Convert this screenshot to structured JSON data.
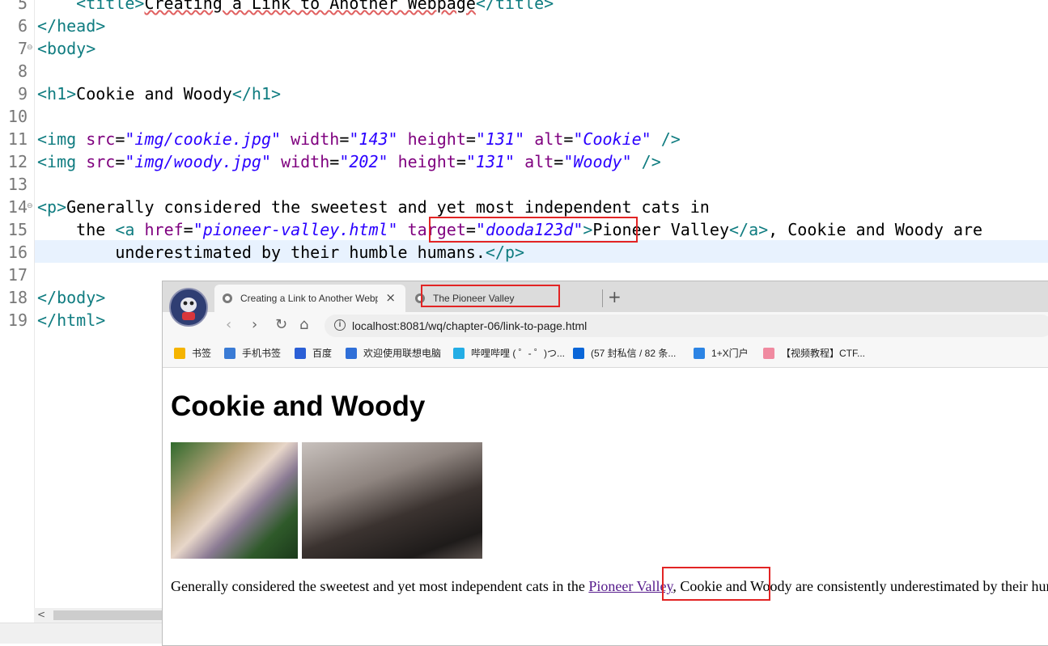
{
  "editor": {
    "line_numbers": [
      "5",
      "6",
      "7",
      "8",
      "9",
      "10",
      "11",
      "12",
      "13",
      "14",
      "15",
      "16",
      "17",
      "18",
      "19"
    ],
    "lines": {
      "l5": {
        "open": "<title>",
        "text": "Creating a Link to Another Webpage",
        "close": "</title>"
      },
      "l6": "</head>",
      "l7": "<body>",
      "l9": {
        "open": "<h1>",
        "text": "Cookie and Woody",
        "close": "</h1>"
      },
      "l11": {
        "tag": "<img",
        "src_attr": "src",
        "src": "\"img/cookie.jpg\"",
        "w_attr": "width",
        "w": "\"143\"",
        "h_attr": "height",
        "h": "\"131\"",
        "alt_attr": "alt",
        "alt": "\"Cookie\"",
        "end": "/>"
      },
      "l12": {
        "tag": "<img",
        "src_attr": "src",
        "src": "\"img/woody.jpg\"",
        "w_attr": "width",
        "w": "\"202\"",
        "h_attr": "height",
        "h": "\"131\"",
        "alt_attr": "alt",
        "alt": "\"Woody\"",
        "end": "/>"
      },
      "l14": {
        "open": "<p>",
        "text": "Generally considered the sweetest and yet most independent cats in"
      },
      "l15": {
        "pre": "the ",
        "tag": "<a",
        "href_attr": "href",
        "href": "\"pioneer-valley.html\"",
        "target_attr": "target",
        "target": "\"dooda123d\"",
        "gt": ">",
        "text": "Pioneer Valley",
        "close": "</a>",
        "post": ", Cookie and Woody are"
      },
      "l16": {
        "text": "underestimated by their humble humans.",
        "close": "</p>"
      },
      "l18": "</body>",
      "l19": "</html>"
    },
    "fold_marker": "⊖",
    "scroll_left_arrow": "<"
  },
  "browser": {
    "tabs": [
      {
        "title": "Creating a Link to Another Webpage",
        "close": "×"
      },
      {
        "title": "The Pioneer Valley"
      }
    ],
    "new_tab": "+",
    "nav": {
      "back": "‹",
      "forward": "›",
      "reload": "↻",
      "home": "⌂"
    },
    "address": {
      "info": "i",
      "url": "localhost:8081/wq/chapter-06/link-to-page.html"
    },
    "bookmarks": [
      {
        "label": "书签",
        "icon": "star-icon",
        "color": "#f5b400"
      },
      {
        "label": "手机书签",
        "icon": "phone-icon",
        "color": "#3a7bd5"
      },
      {
        "label": "百度",
        "icon": "baidu-icon",
        "color": "#2b5fd6"
      },
      {
        "label": "欢迎使用联想电脑",
        "icon": "lenovo-icon",
        "color": "#2f6fd8"
      },
      {
        "label": "哔哩哔哩 ( ゜- ゜)つ...",
        "icon": "bilibili-icon",
        "color": "#23ade5"
      },
      {
        "label": "(57 封私信 / 82 条...",
        "icon": "zhihu-icon",
        "color": "#0a66d8"
      },
      {
        "label": "1+X门户",
        "icon": "cloud-icon",
        "color": "#2c84e4"
      },
      {
        "label": "【视频教程】CTF...",
        "icon": "pig-icon",
        "color": "#f08aa0"
      }
    ],
    "page": {
      "heading": "Cookie and Woody",
      "para_before": "Generally considered the sweetest and yet most independent cats in the ",
      "link_text": "Pioneer Valley",
      "para_after": ", Cookie and Woody are consistently underestimated by their humble humans."
    }
  },
  "colors": {
    "highlight_box": "#e22424",
    "link_visited": "#551a8b",
    "tag": "#0f7c80",
    "attr_name": "#7f007f",
    "attr_value": "#2a00ff"
  }
}
